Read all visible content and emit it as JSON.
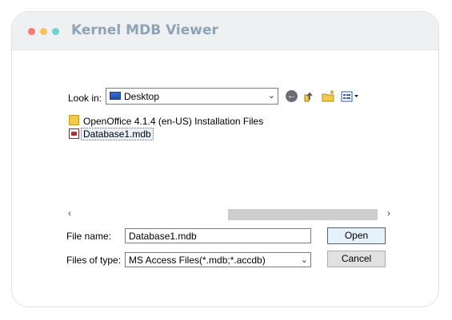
{
  "app": {
    "title": "Kernel MDB Viewer"
  },
  "dialog": {
    "look_in": {
      "label": "Look in:",
      "value": "Desktop",
      "icon": "desktop-icon"
    },
    "toolbar": {
      "back_icon": "back-arrow-icon",
      "up_icon": "up-folder-icon",
      "new_folder_icon": "new-folder-icon",
      "view_menu_icon": "view-menu-icon"
    },
    "files": [
      {
        "name": "OpenOffice 4.1.4 (en-US) Installation Files",
        "type": "folder",
        "selected": false
      },
      {
        "name": "Database1.mdb",
        "type": "mdb-file",
        "selected": true
      }
    ],
    "file_name": {
      "label": "File name:",
      "value": "Database1.mdb"
    },
    "files_of_type": {
      "label": "Files of type:",
      "value": "MS Access Files(*.mdb;*.accdb)"
    },
    "buttons": {
      "open": "Open",
      "cancel": "Cancel"
    }
  },
  "colors": {
    "title_text": "#8ea3b8",
    "titlebar_bg": "#eef0f2",
    "dot_red": "#f47a72",
    "dot_yellow": "#f8c25a",
    "dot_teal": "#6cd4cf",
    "default_button_border": "#0078d7"
  }
}
